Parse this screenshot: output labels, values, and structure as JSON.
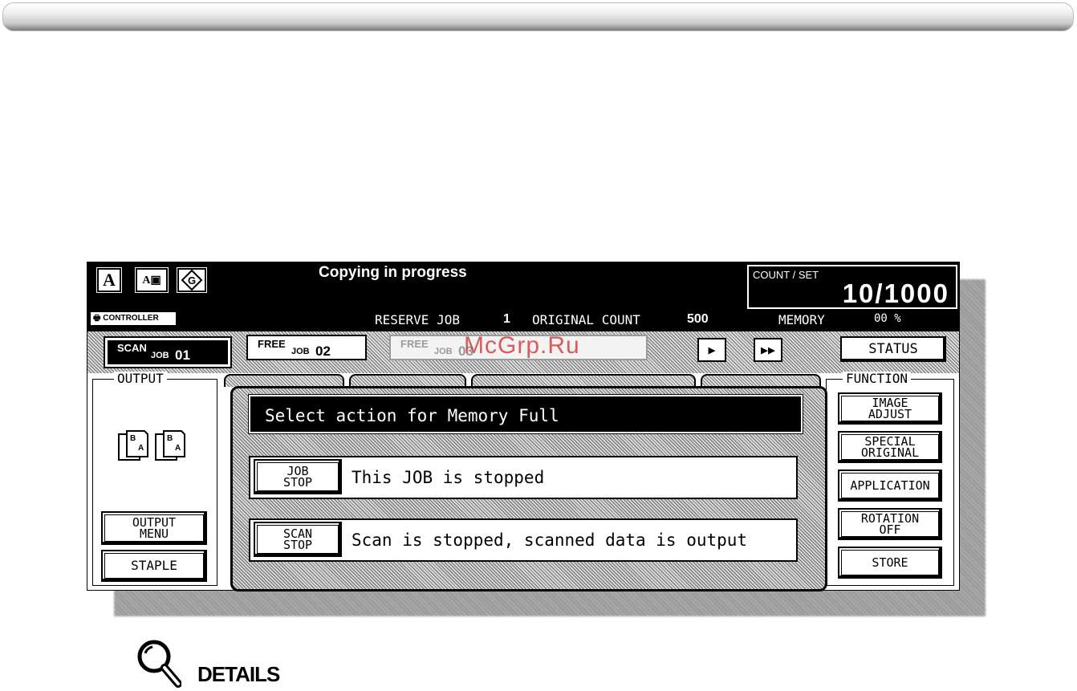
{
  "watermark": "McGrp.Ru",
  "header": {
    "status_text": "Copying in progress",
    "controller_label": "CONTROLLER",
    "count_label": "COUNT / SET",
    "count_value": "10/1000",
    "reserve_job_label": "RESERVE JOB",
    "reserve_job_value": "1",
    "original_count_label": "ORIGINAL COUNT",
    "original_count_value": "500",
    "memory_label": "MEMORY",
    "memory_value": "00 %"
  },
  "jobs": [
    {
      "label": "SCAN",
      "job_word": "JOB",
      "number": "01",
      "active": true
    },
    {
      "label": "FREE",
      "job_word": "JOB",
      "number": "02",
      "active": false
    },
    {
      "label": "FREE",
      "job_word": "JOB",
      "number": "03",
      "active": false,
      "disabled": true
    }
  ],
  "nav": {
    "next": "▶",
    "last": "▶▶"
  },
  "status_button": "STATUS",
  "output": {
    "title": "OUTPUT",
    "output_menu_button": "OUTPUT\nMENU",
    "staple_button": "STAPLE"
  },
  "function": {
    "title": "FUNCTION",
    "buttons": [
      "IMAGE\nADJUST",
      "SPECIAL\nORIGINAL",
      "APPLICATION",
      "ROTATION\nOFF",
      "STORE"
    ]
  },
  "dialog": {
    "title": "Select action for Memory Full",
    "options": [
      {
        "button": "JOB\nSTOP",
        "text": "This JOB is stopped"
      },
      {
        "button": "SCAN\nSTOP",
        "text": "Scan is stopped, scanned data is output"
      }
    ]
  },
  "details": {
    "label": "DETAILS",
    "icon": "magnifier-icon"
  }
}
